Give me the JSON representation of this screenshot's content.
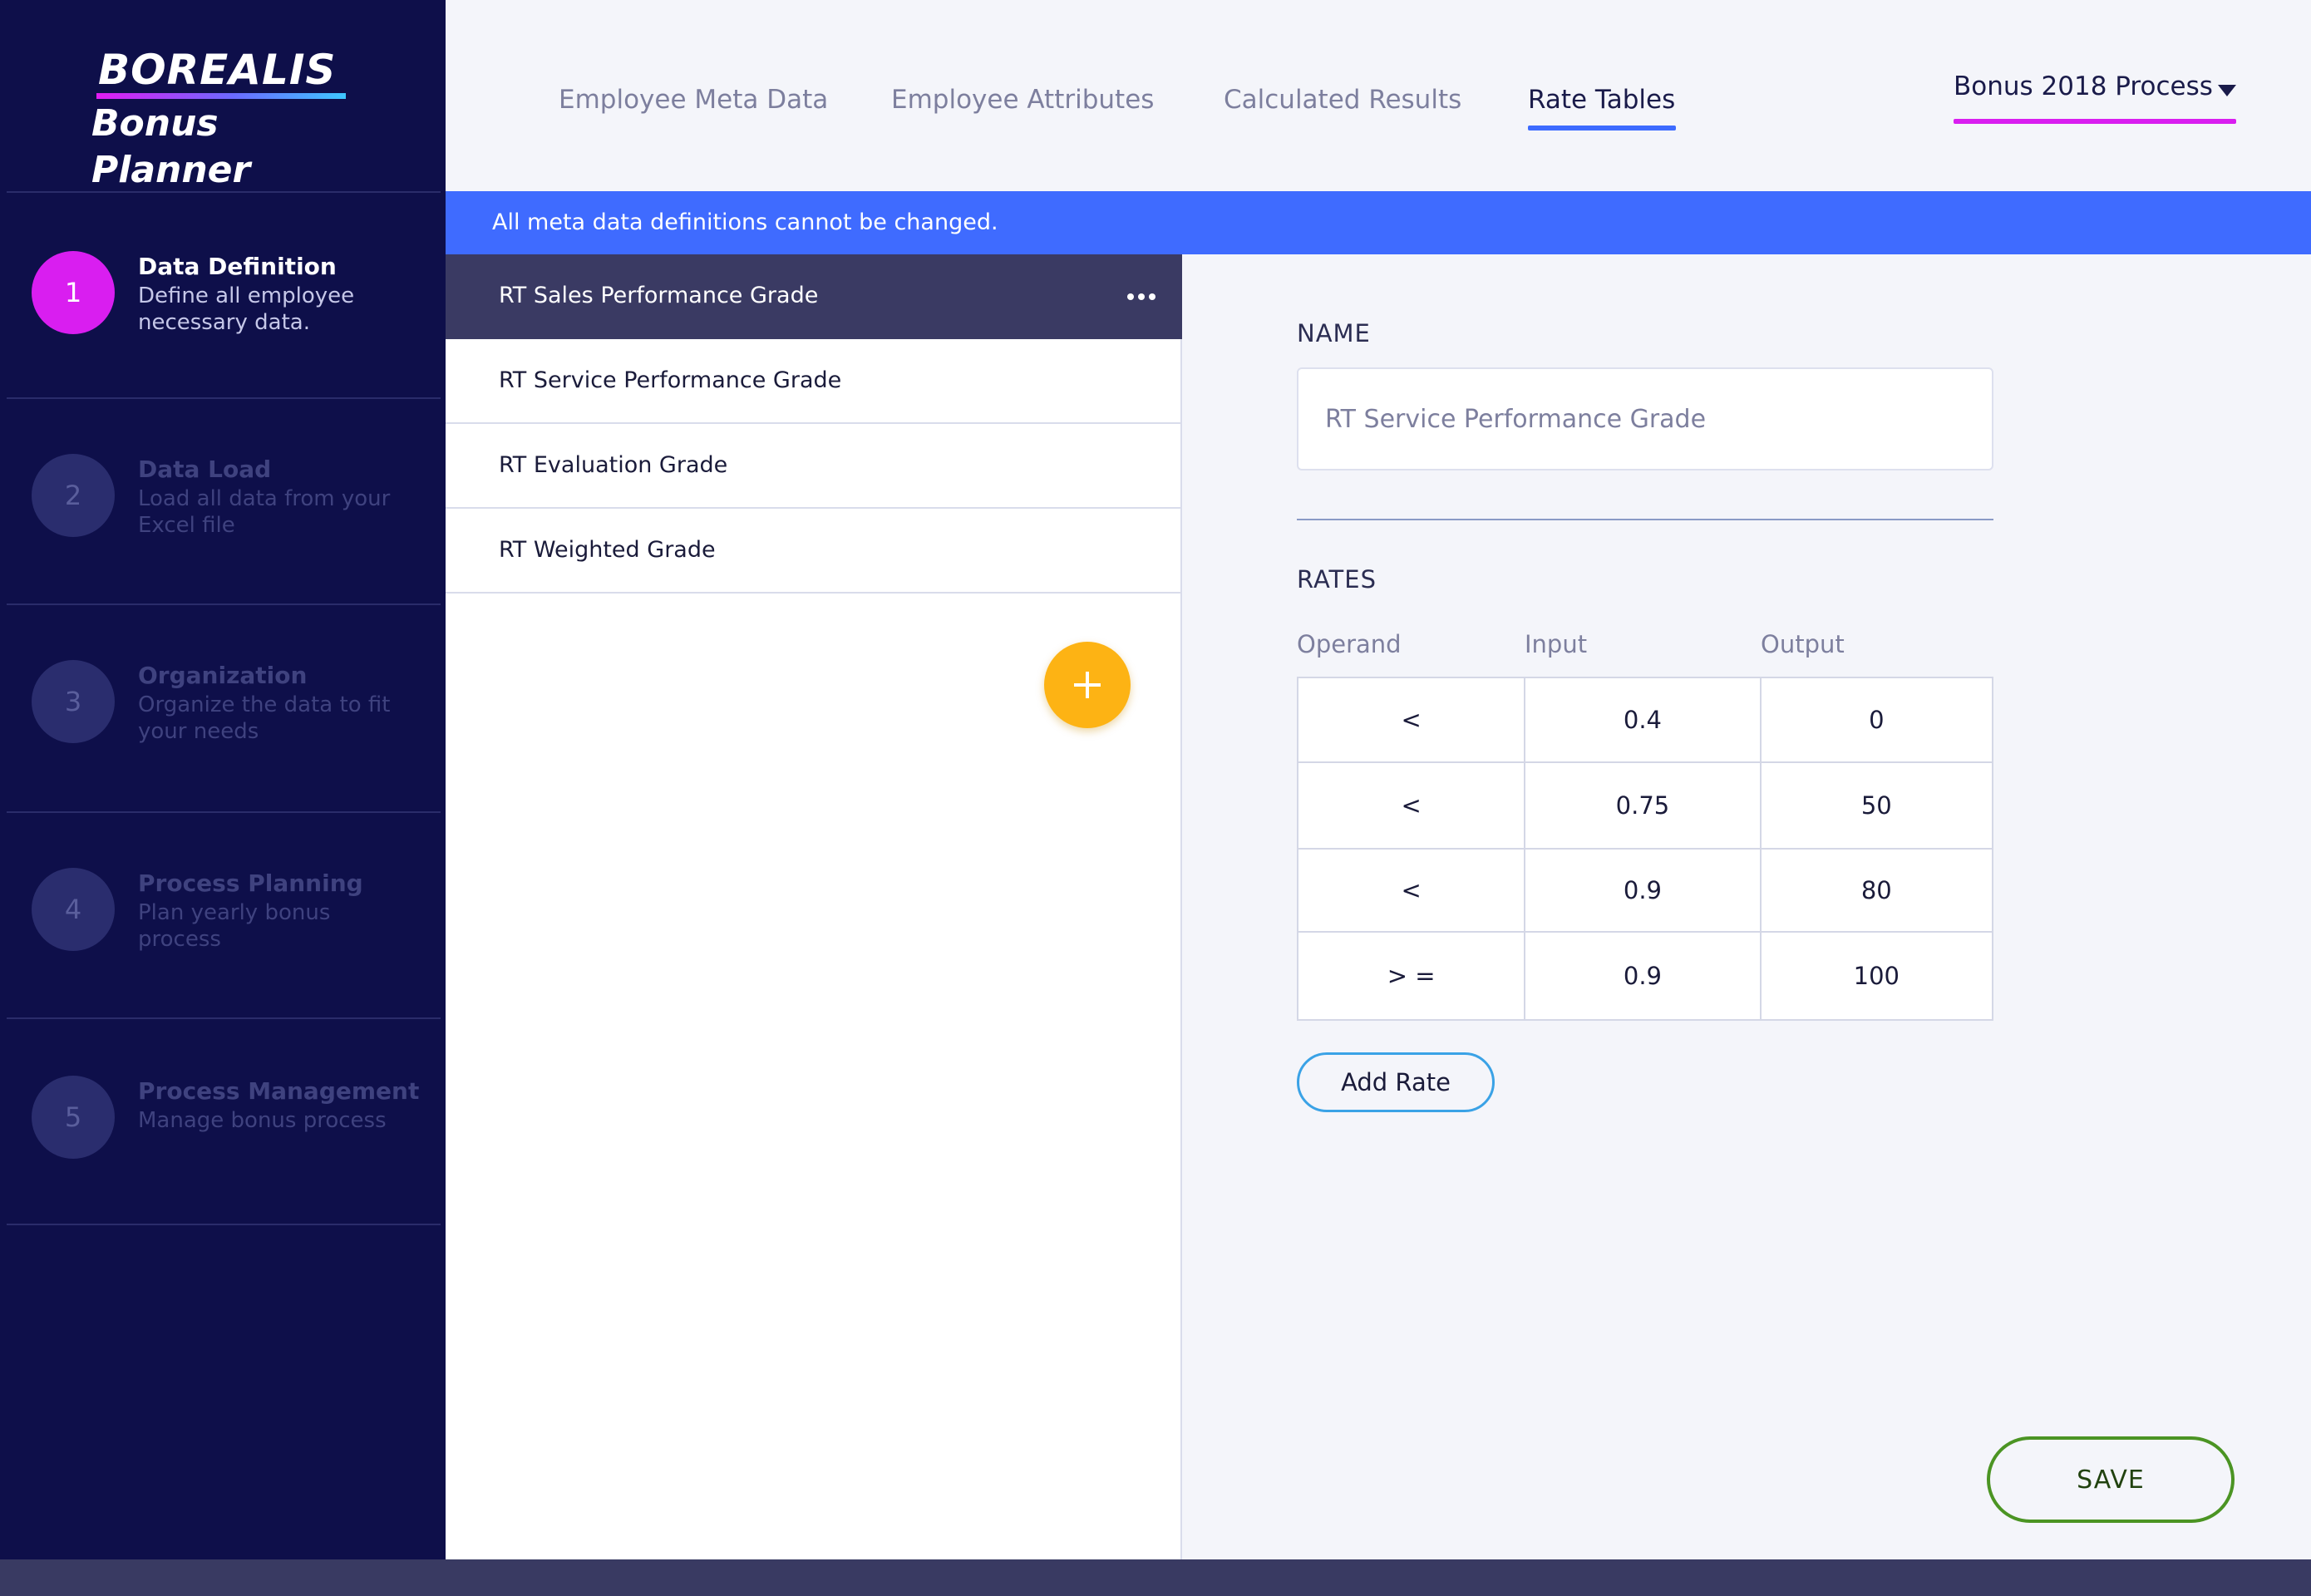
{
  "logo": {
    "top": "BOREALIS",
    "bottom": "Bonus Planner"
  },
  "steps": [
    {
      "number": "1",
      "title": "Data Definition",
      "desc": "Define all employee necessary data."
    },
    {
      "number": "2",
      "title": "Data Load",
      "desc": "Load all data from your Excel file"
    },
    {
      "number": "3",
      "title": "Organization",
      "desc": "Organize the data to fit your needs"
    },
    {
      "number": "4",
      "title": "Process Planning",
      "desc": "Plan yearly bonus process"
    },
    {
      "number": "5",
      "title": "Process Management",
      "desc": "Manage bonus process"
    }
  ],
  "tabs": [
    {
      "label": "Employee Meta Data"
    },
    {
      "label": "Employee Attributes"
    },
    {
      "label": "Calculated Results"
    },
    {
      "label": "Rate Tables"
    }
  ],
  "process_select": {
    "value": "Bonus 2018 Process"
  },
  "banner": {
    "text": "All meta data definitions cannot be changed."
  },
  "list": [
    {
      "label": "RT Sales Performance Grade"
    },
    {
      "label": "RT Service Performance Grade"
    },
    {
      "label": "RT Evaluation Grade"
    },
    {
      "label": "RT Weighted Grade"
    }
  ],
  "detail": {
    "name_label": "NAME",
    "name_placeholder": "RT Service Performance Grade",
    "rates_label": "RATES",
    "columns": [
      "Operand",
      "Input",
      "Output"
    ],
    "rows": [
      {
        "operand": "<",
        "input": "0.4",
        "output": "0"
      },
      {
        "operand": "<",
        "input": "0.75",
        "output": "50"
      },
      {
        "operand": "<",
        "input": "0.9",
        "output": "80"
      },
      {
        "operand": "> =",
        "input": "0.9",
        "output": "100"
      }
    ],
    "add_rate_label": "Add Rate"
  },
  "save_label": "SAVE",
  "colors": {
    "sidebar": "#0e0f4a",
    "accent_magenta": "#d91ef0",
    "banner_blue": "#3f6bff",
    "fab_yellow": "#fdb314",
    "save_green": "#4b9423"
  }
}
